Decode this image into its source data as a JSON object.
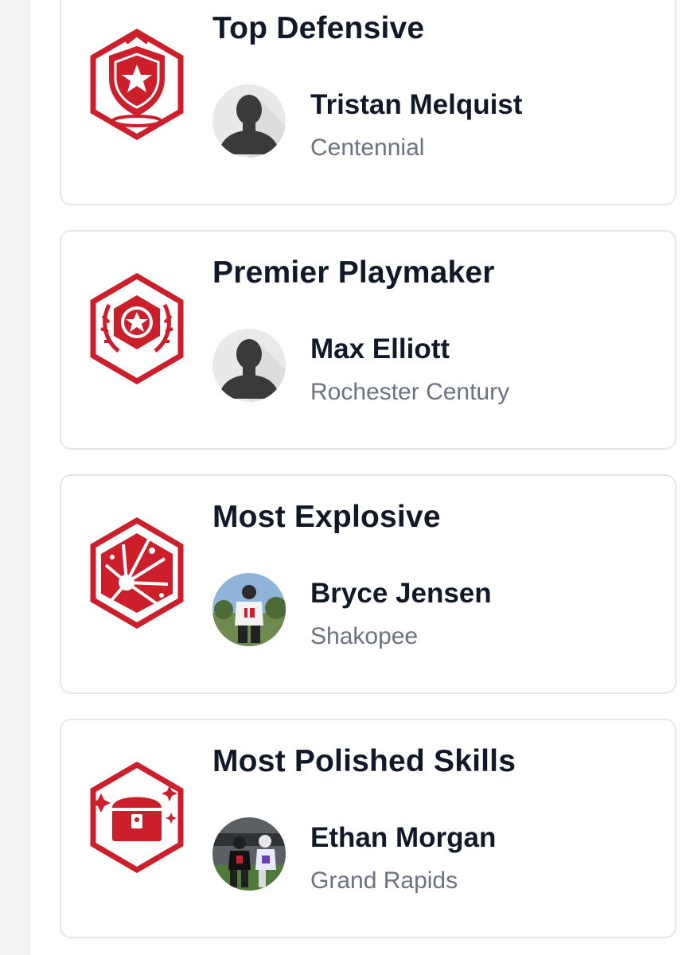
{
  "colors": {
    "accent": "#cc1f2b",
    "title_text": "#111827",
    "secondary_text": "#6b7280",
    "card_border": "#e5e7eb",
    "rail": "#f3f4f6"
  },
  "awards": [
    {
      "title": "Top Defensive",
      "icon": "shield-star-icon",
      "player": {
        "name": "Tristan Melquist",
        "school": "Centennial",
        "avatar": "default-avatar-icon"
      }
    },
    {
      "title": "Premier Playmaker",
      "icon": "star-wings-icon",
      "player": {
        "name": "Max Elliott",
        "school": "Rochester Century",
        "avatar": "default-avatar-icon"
      }
    },
    {
      "title": "Most Explosive",
      "icon": "explosion-icon",
      "player": {
        "name": "Bryce Jensen",
        "school": "Shakopee",
        "avatar": "player-photo"
      }
    },
    {
      "title": "Most Polished Skills",
      "icon": "treasure-chest-sparkle-icon",
      "player": {
        "name": "Ethan Morgan",
        "school": "Grand Rapids",
        "avatar": "player-photo"
      }
    }
  ]
}
